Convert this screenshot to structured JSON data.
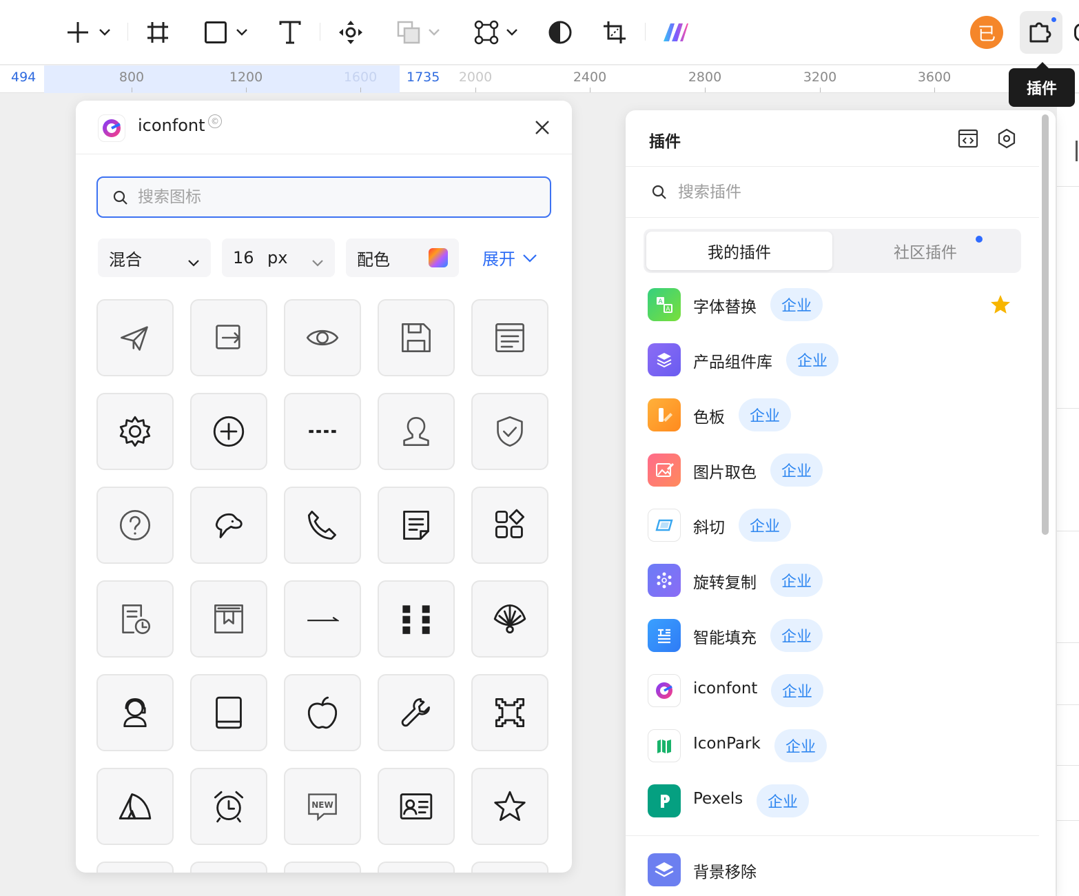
{
  "toolbar": {
    "tools": [
      {
        "name": "add-tool",
        "icon": "plus-icon",
        "has_dropdown": true
      },
      {
        "name": "frame-tool",
        "icon": "frame-icon",
        "has_dropdown": false
      },
      {
        "name": "shape-tool",
        "icon": "rectangle-icon",
        "has_dropdown": true
      },
      {
        "name": "text-tool",
        "icon": "text-icon",
        "has_dropdown": false
      },
      {
        "name": "component-tool",
        "icon": "component-icon",
        "has_dropdown": false
      },
      {
        "name": "boolean-tool",
        "icon": "boolean-icon",
        "has_dropdown": true
      },
      {
        "name": "vector-tool",
        "icon": "vector-icon",
        "has_dropdown": true
      },
      {
        "name": "mask-tool",
        "icon": "contrast-icon",
        "has_dropdown": false
      },
      {
        "name": "crop-tool",
        "icon": "crop-icon",
        "has_dropdown": false
      },
      {
        "name": "ai-tool",
        "icon": "ai-logo-icon",
        "has_dropdown": false
      }
    ],
    "avatar_text": "已",
    "plugin_tooltip": "插件"
  },
  "ruler": {
    "selection_start": "494",
    "selection_end": "1735",
    "labels": [
      "800",
      "1200",
      "1600",
      "2000",
      "2400",
      "2800",
      "3200",
      "3600"
    ]
  },
  "iconfont": {
    "title": "iconfont",
    "copyright_mark": "©",
    "search_placeholder": "搜索图标",
    "mode_label": "混合",
    "size_value": "16",
    "size_unit": "px",
    "color_label": "配色",
    "expand_label": "展开",
    "icons": [
      "send-icon",
      "logout-icon",
      "eye-icon",
      "save-icon",
      "document-icon",
      "settings-icon",
      "add-circle-icon",
      "dotted-line-icon",
      "user-icon",
      "shield-check-icon",
      "help-icon",
      "dog-icon",
      "phone-icon",
      "notes-icon",
      "apps-icon",
      "file-time-icon",
      "archive-icon",
      "arrow-right-icon",
      "grid-dots-icon",
      "fan-icon",
      "customer-service-icon",
      "tablet-icon",
      "apple-icon",
      "wrench-icon",
      "pixel-frame-icon",
      "tent-icon",
      "alarm-clock-icon",
      "new-badge-icon",
      "id-card-icon",
      "star-icon"
    ]
  },
  "plugins": {
    "title": "插件",
    "search_placeholder": "搜索插件",
    "tabs": [
      {
        "label": "我的插件",
        "active": true
      },
      {
        "label": "社区插件",
        "active": false,
        "has_dot": true
      }
    ],
    "badge_label": "企业",
    "items": [
      {
        "name": "字体替换",
        "icon": "font-replace-icon",
        "starred": true
      },
      {
        "name": "产品组件库",
        "icon": "component-library-icon",
        "starred": false
      },
      {
        "name": "色板",
        "icon": "palette-icon",
        "starred": false
      },
      {
        "name": "图片取色",
        "icon": "image-color-picker-icon",
        "starred": false
      },
      {
        "name": "斜切",
        "icon": "skew-icon",
        "starred": false
      },
      {
        "name": "旋转复制",
        "icon": "rotate-copy-icon",
        "starred": false
      },
      {
        "name": "智能填充",
        "icon": "smart-fill-icon",
        "starred": false
      },
      {
        "name": "iconfont",
        "icon": "iconfont-logo-icon",
        "starred": false
      },
      {
        "name": "IconPark",
        "icon": "iconpark-logo-icon",
        "starred": false
      },
      {
        "name": "Pexels",
        "icon": "pexels-logo-icon",
        "starred": false
      }
    ],
    "extra_item": {
      "name": "背景移除",
      "icon": "background-remove-icon"
    }
  },
  "colors": {
    "accent": "#2E6DF5",
    "badge_bg": "#E6F1FF",
    "badge_text": "#2E86F0",
    "avatar": "#F5862A",
    "star": "#F7B500"
  }
}
